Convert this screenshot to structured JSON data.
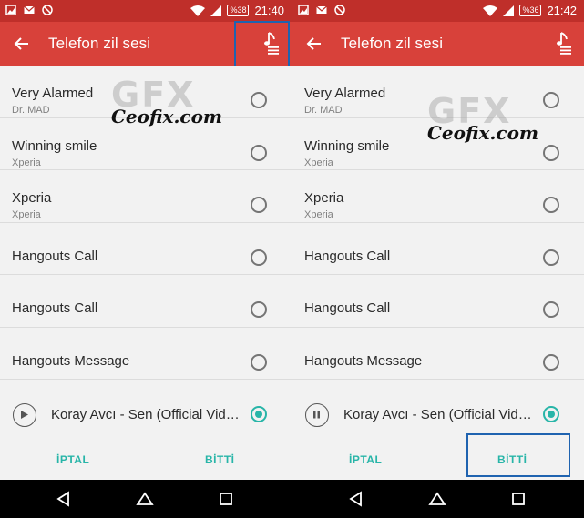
{
  "panels": [
    {
      "status": {
        "battery": "%38",
        "time": "21:40"
      },
      "appbar": {
        "title": "Telefon zil sesi"
      },
      "items": [
        {
          "title": "Very Alarmed",
          "subtitle": "Dr. MAD"
        },
        {
          "title": "Winning smile",
          "subtitle": "Xperia"
        },
        {
          "title": "Xperia",
          "subtitle": "Xperia"
        },
        {
          "title": "Hangouts Call",
          "subtitle": ""
        },
        {
          "title": "Hangouts Call",
          "subtitle": ""
        },
        {
          "title": "Hangouts Message",
          "subtitle": ""
        }
      ],
      "playing": {
        "title": "Koray Avcı - Sen (Official Vid…",
        "state": "play"
      },
      "actions": {
        "cancel": "İPTAL",
        "done": "BİTTİ"
      },
      "watermark": {
        "logo": "GFX",
        "site": "Ceofix.com"
      }
    },
    {
      "status": {
        "battery": "%36",
        "time": "21:42"
      },
      "appbar": {
        "title": "Telefon zil sesi"
      },
      "items": [
        {
          "title": "Very Alarmed",
          "subtitle": "Dr. MAD"
        },
        {
          "title": "Winning smile",
          "subtitle": "Xperia"
        },
        {
          "title": "Xperia",
          "subtitle": "Xperia"
        },
        {
          "title": "Hangouts Call",
          "subtitle": ""
        },
        {
          "title": "Hangouts Call",
          "subtitle": ""
        },
        {
          "title": "Hangouts Message",
          "subtitle": ""
        }
      ],
      "playing": {
        "title": "Koray Avcı - Sen (Official Vid…",
        "state": "pause"
      },
      "actions": {
        "cancel": "İPTAL",
        "done": "BİTTİ"
      },
      "watermark": {
        "logo": "GFX",
        "site": "Ceofix.com"
      }
    }
  ],
  "colors": {
    "statusbar": "#bf2f2a",
    "appbar": "#d8413a",
    "accent": "#28b5a8",
    "highlight": "#1f63b0"
  },
  "icons": {
    "back": "arrow-back-icon",
    "music": "music-list-icon",
    "play": "play-icon",
    "pause": "pause-icon",
    "nav_back": "triangle-back-icon",
    "nav_home": "home-icon",
    "nav_recent": "square-recent-icon"
  }
}
